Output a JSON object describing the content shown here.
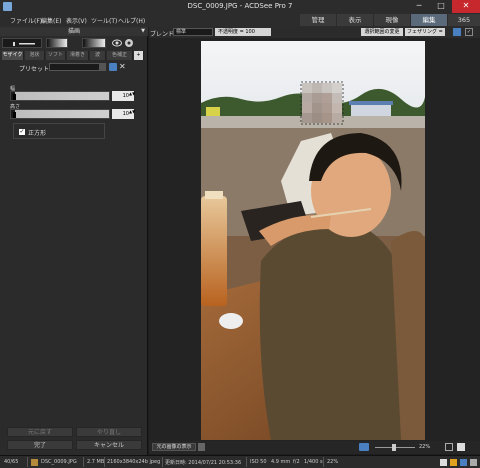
{
  "window": {
    "title": "DSC_0009.JPG - ACDSee Pro 7",
    "minimize": "─",
    "maximize": "□",
    "close": "✕"
  },
  "menu": [
    {
      "label": "ファイル(F)"
    },
    {
      "label": "編集(E)"
    },
    {
      "label": "表示(V)"
    },
    {
      "label": "ツール(T)"
    },
    {
      "label": "ヘルプ(H)"
    }
  ],
  "mode_tabs": [
    {
      "label": "管理",
      "active": false
    },
    {
      "label": "表示",
      "active": false
    },
    {
      "label": "現像",
      "active": false
    },
    {
      "label": "編集",
      "active": true
    },
    {
      "label": "365",
      "active": false
    }
  ],
  "left_panel": {
    "header": "描画",
    "header_arrow": "▼",
    "sub_tabs": [
      "モザイク",
      "泡状",
      "ソフト",
      "滑着き",
      "波",
      "色補正",
      "+"
    ],
    "preset_label": "プリセット",
    "delete_symbol": "✕",
    "sliders": [
      {
        "label": "幅",
        "value": "10",
        "spin": "▲▼"
      },
      {
        "label": "高さ",
        "value": "10",
        "spin": "▲▼"
      }
    ],
    "checkbox_label": "正方形",
    "checkbox_checked": true,
    "checkbox_mark": "✓",
    "buttons": {
      "undo": "元に戻す",
      "redo": "やり直し",
      "done": "完了",
      "cancel": "キャンセル"
    }
  },
  "toolbar": {
    "blend_label": "ブレンド",
    "blend_value": "標準",
    "opacity_label": "不透明度 = 100",
    "change_selection": "選択範囲の変更",
    "feather_label": "フェザリング = 0"
  },
  "image_bar": {
    "show_original": "元の画像の表示",
    "zoom": "22%"
  },
  "status": {
    "index": "40/65",
    "filename": "DSC_0009.JPG",
    "filesize": "2.7 MB",
    "dimensions": "2160x3840x24b jpeg",
    "modified": "更新日時: 2014/07/21 20:53:36",
    "iso": "ISO 50",
    "focal": "4.9 mm",
    "aperture": "f/2",
    "shutter": "1/400 s",
    "zoom": "22%"
  },
  "colors": {
    "accent": "#4a7fc0",
    "close": "#c6282e",
    "active_tab": "#5a6a7a"
  }
}
